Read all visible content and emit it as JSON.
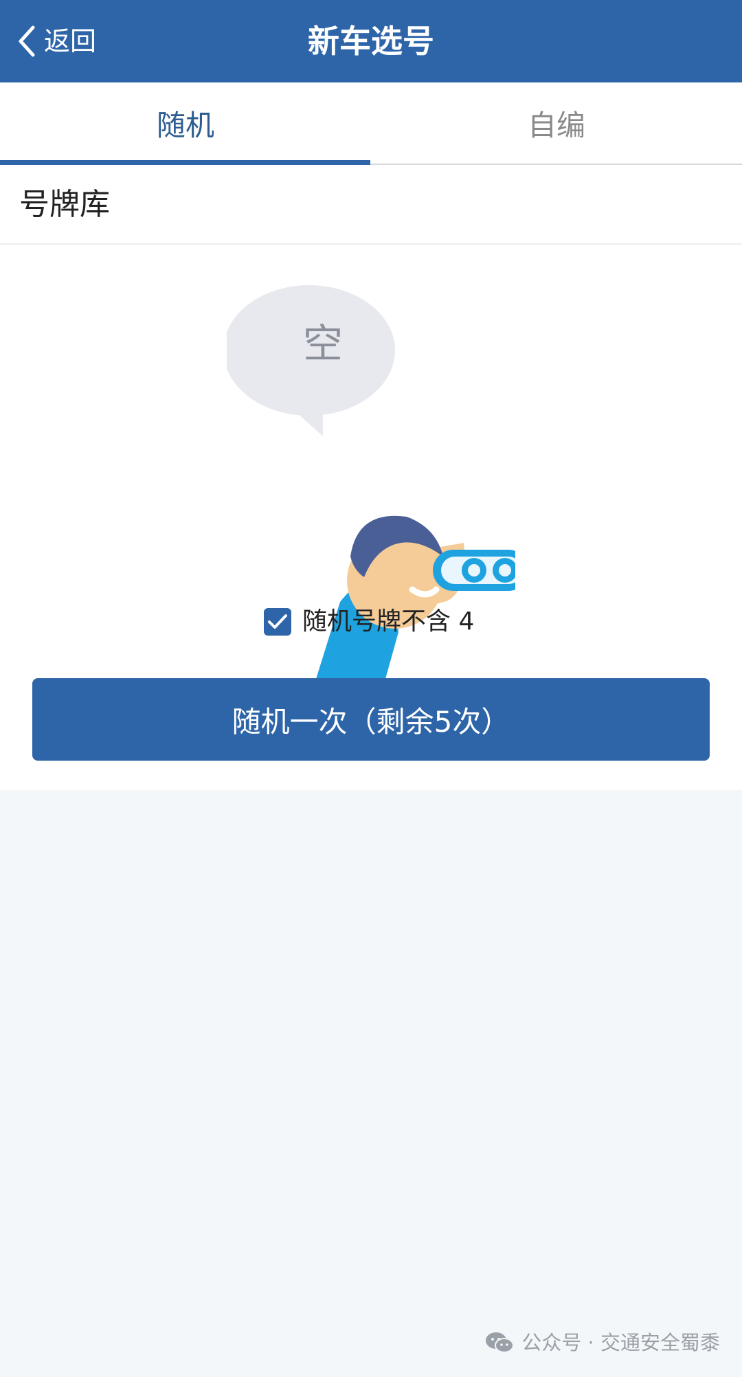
{
  "header": {
    "back_label": "返回",
    "title": "新车选号"
  },
  "tabs": [
    {
      "label": "随机",
      "active": true
    },
    {
      "label": "自编",
      "active": false
    }
  ],
  "section": {
    "title": "号牌库"
  },
  "empty_state": {
    "text": "空",
    "icon": "person-with-binoculars"
  },
  "option": {
    "checked": true,
    "label": "随机号牌不含 4"
  },
  "action": {
    "button_label": "随机一次（剩余5次）"
  },
  "watermark": {
    "text": "公众号 · 交通安全蜀黍",
    "icon": "wechat-icon"
  },
  "colors": {
    "primary": "#2d65a8",
    "active_tab_text": "#2d5d90",
    "inactive_tab_text": "#8a8a8a",
    "page_background": "#f4f7f9",
    "illustration_shirt": "#1ea3e0",
    "illustration_hair": "#4a5f96",
    "illustration_skin": "#f5cb97"
  }
}
